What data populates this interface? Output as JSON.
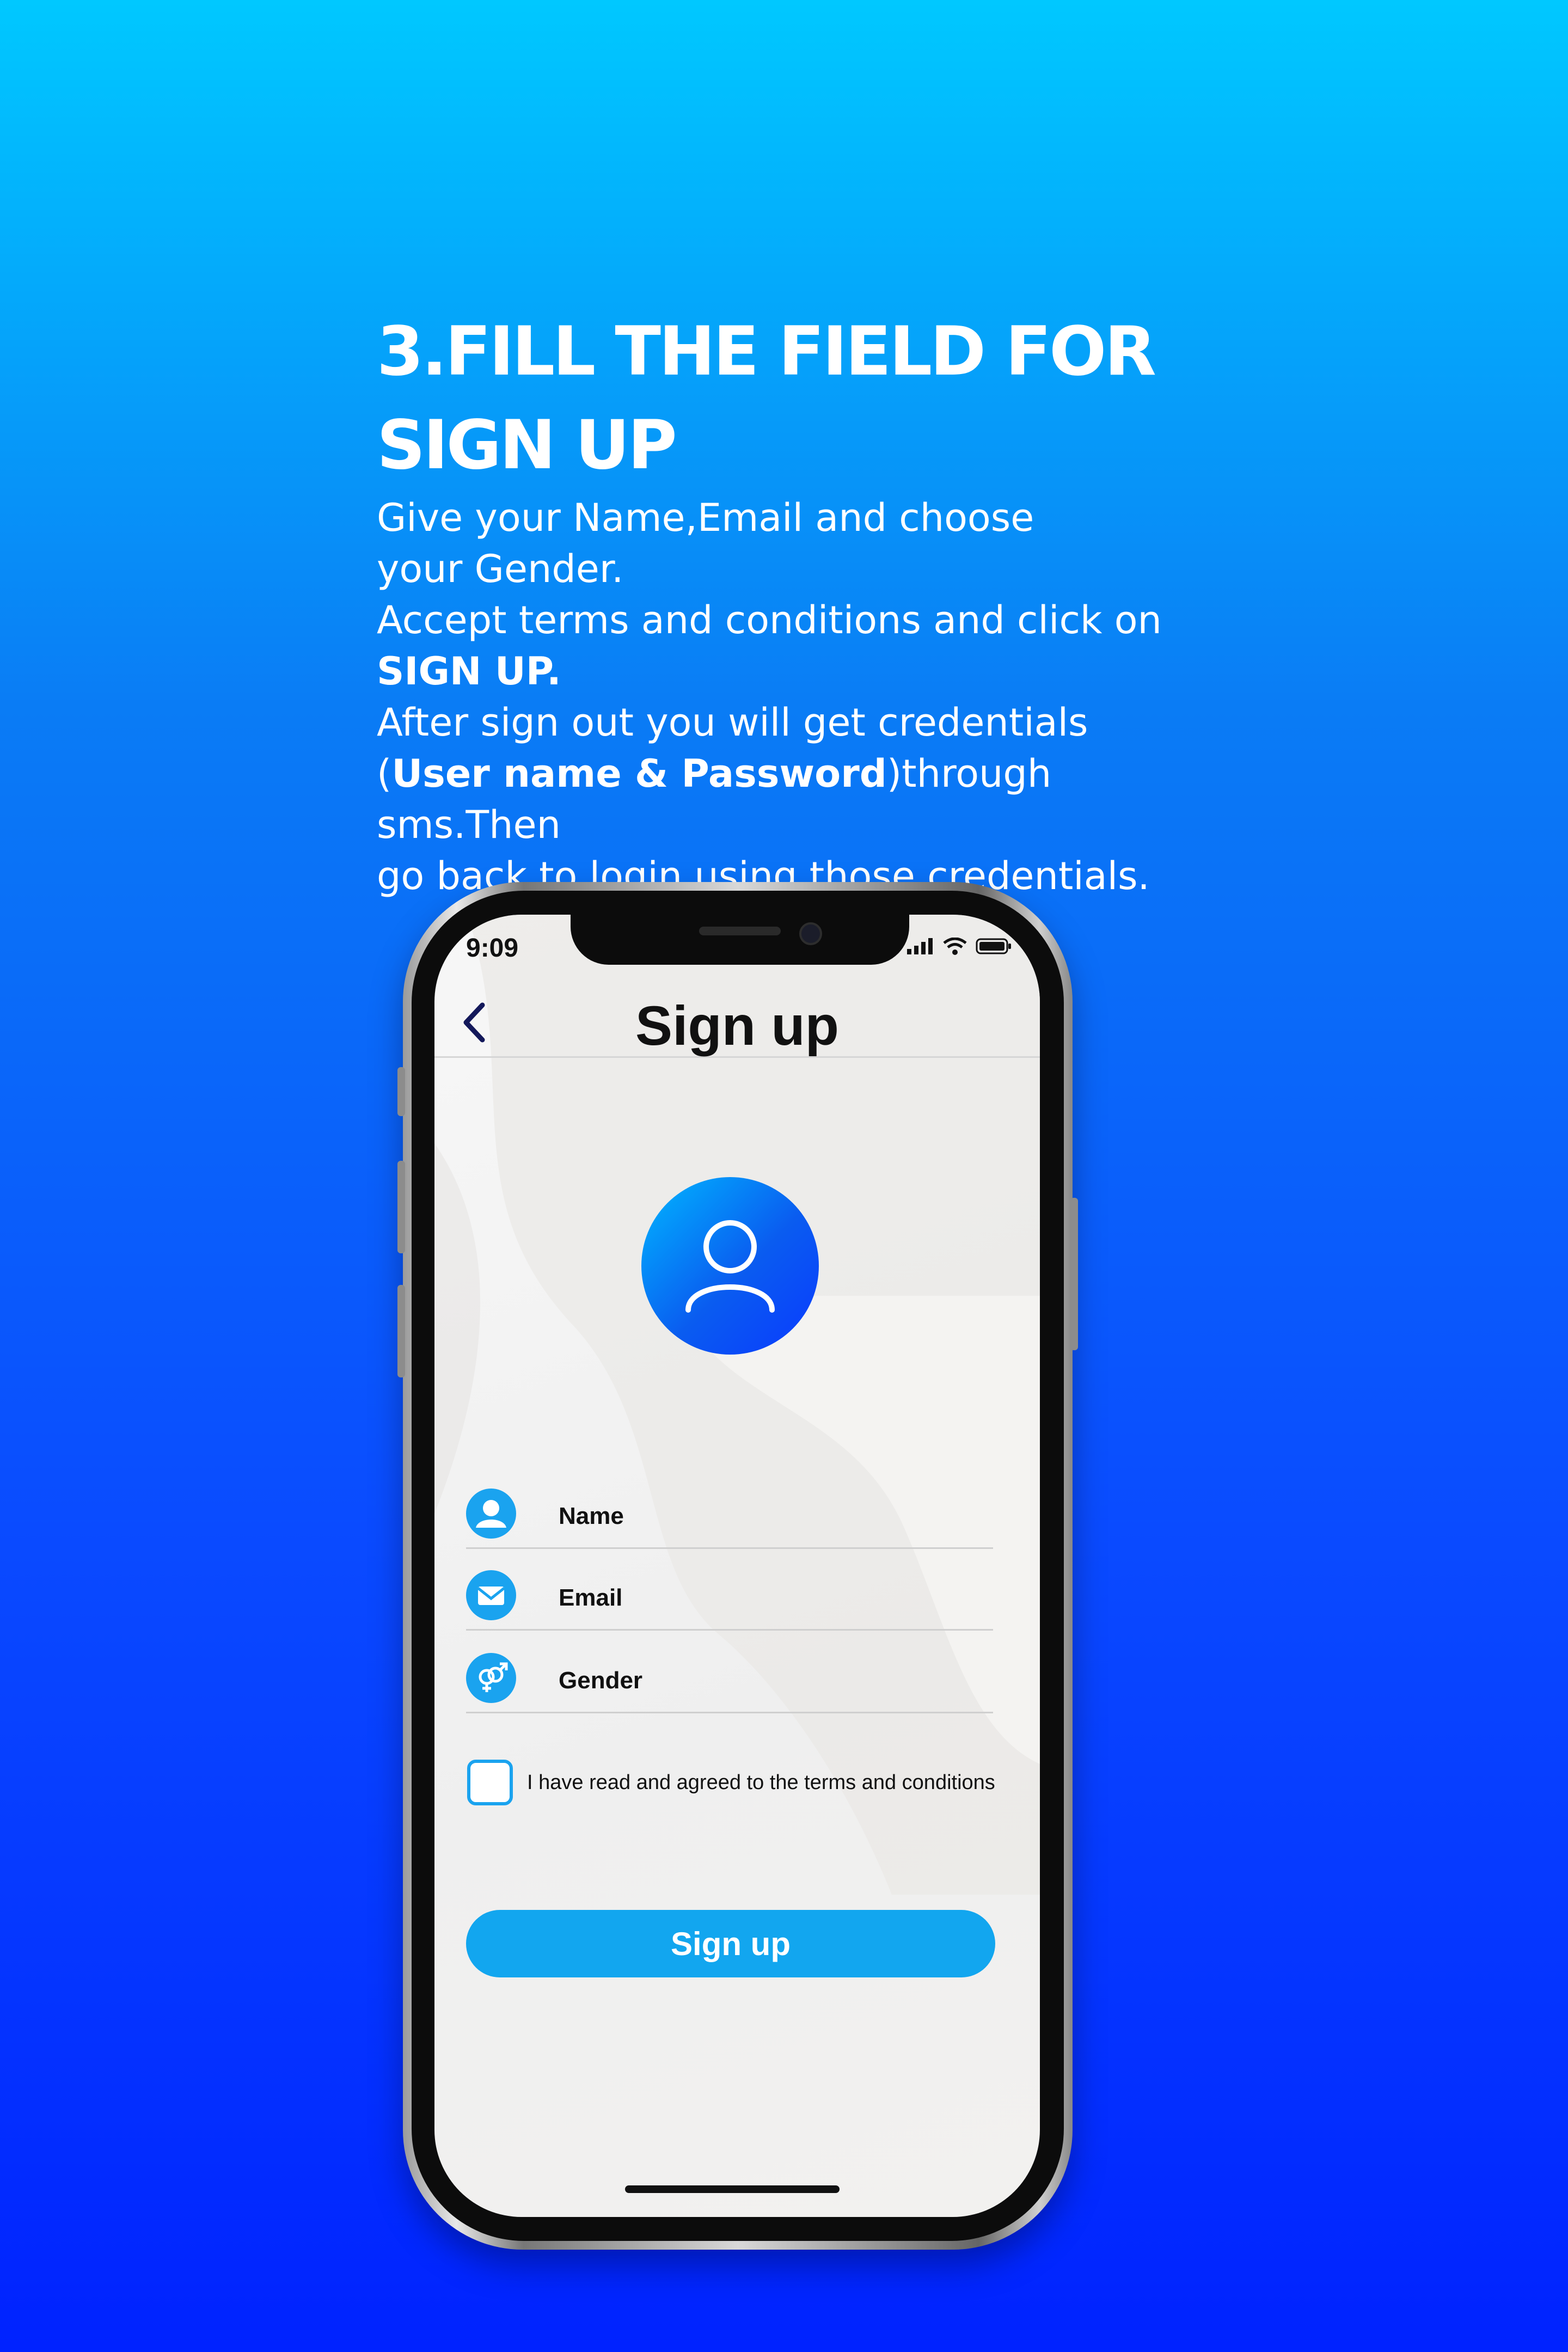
{
  "promo": {
    "headline_line1": "3.FILL THE FIELD FOR",
    "headline_line2": "SIGN UP",
    "desc_line1": "Give your Name,Email and choose",
    "desc_line2": "your Gender.",
    "desc_line3": "Accept terms and conditions and click on",
    "desc_line4_bold": "SIGN UP.",
    "desc_line5": "After sign out you will get credentials",
    "desc_line6_open": "(",
    "desc_line6_bold": "User name & Password",
    "desc_line6_rest": ")through sms.Then",
    "desc_line7": "go back to login using those credentials."
  },
  "status_bar": {
    "time": "9:09",
    "icons": [
      "signal-icon",
      "wifi-icon",
      "battery-icon"
    ]
  },
  "header": {
    "title": "Sign up",
    "back_icon": "chevron-left-icon"
  },
  "form": {
    "avatar_icon": "user-icon",
    "fields": [
      {
        "label": "Name",
        "icon": "person-icon"
      },
      {
        "label": "Email",
        "icon": "envelope-icon"
      },
      {
        "label": "Gender",
        "icon": "gender-icon"
      }
    ],
    "terms_label": "I have read and agreed to the terms and conditions",
    "terms_checked": false,
    "submit_label": "Sign up"
  },
  "colors": {
    "accent": "#12a6ef",
    "background_top": "#00c8ff",
    "background_bottom": "#0022ff"
  }
}
